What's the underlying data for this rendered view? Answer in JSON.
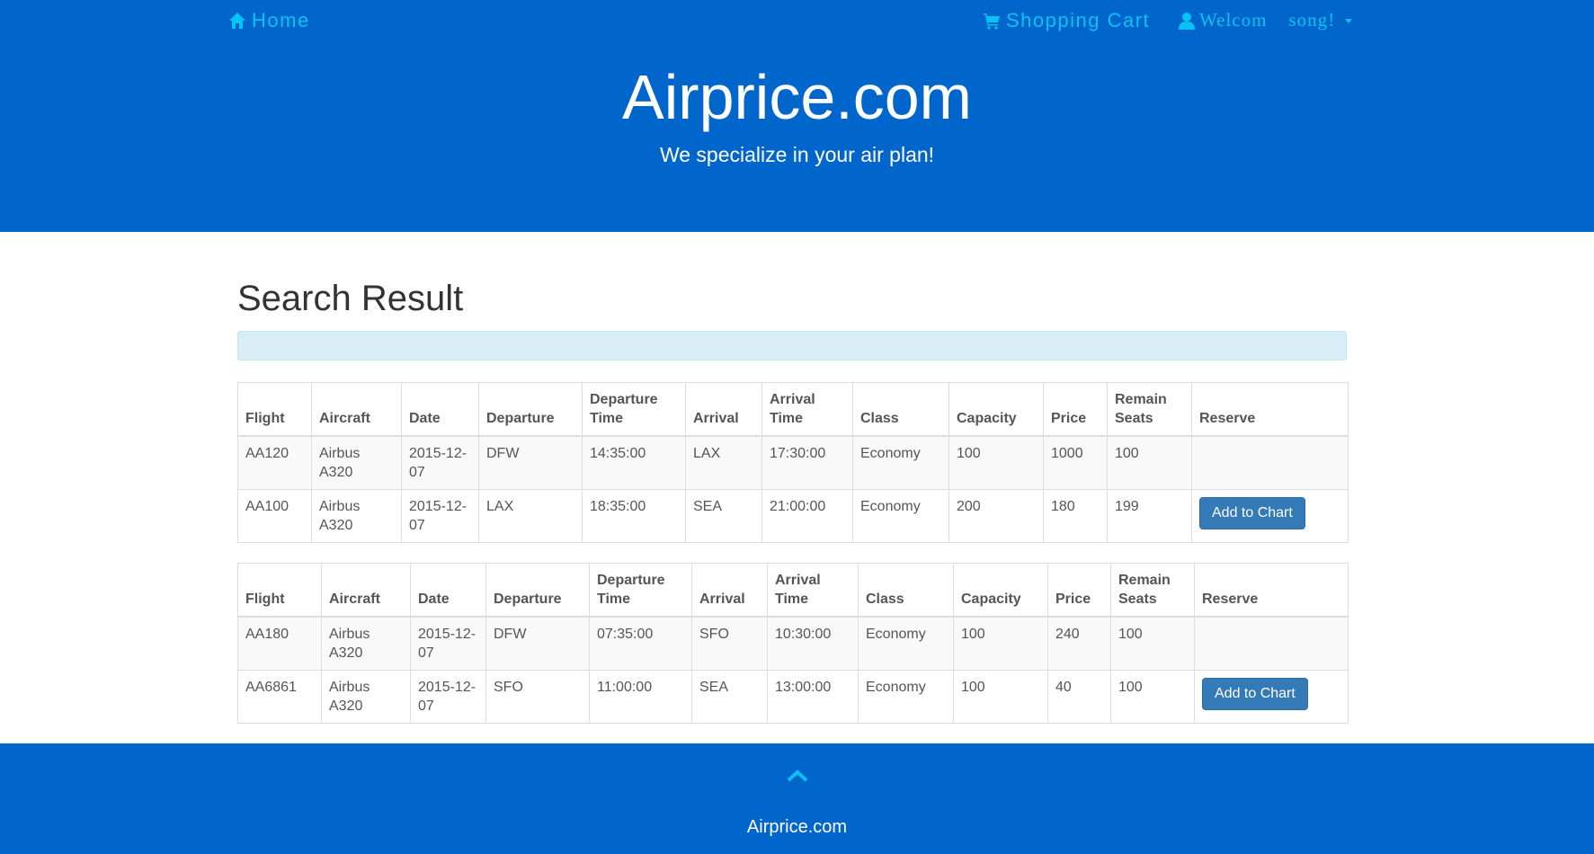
{
  "nav": {
    "home_label": "Home",
    "cart_label": "Shopping Cart",
    "welcome_label": "Welcom",
    "username": "song!"
  },
  "hero": {
    "title": "Airprice.com",
    "subtitle": "We specialize in your air plan!"
  },
  "main": {
    "heading": "Search Result"
  },
  "table_headers": {
    "flight": "Flight",
    "aircraft": "Aircraft",
    "date": "Date",
    "departure": "Departure",
    "departure_time": "Departure Time",
    "arrival": "Arrival",
    "arrival_time": "Arrival Time",
    "class": "Class",
    "capacity": "Capacity",
    "price": "Price",
    "remain_seats": "Remain Seats",
    "reserve": "Reserve"
  },
  "tables": [
    {
      "rows": [
        {
          "flight": "AA120",
          "aircraft": "Airbus A320",
          "date": "2015-12-07",
          "departure": "DFW",
          "departure_time": "14:35:00",
          "arrival": "LAX",
          "arrival_time": "17:30:00",
          "class": "Economy",
          "capacity": "100",
          "price": "1000",
          "remain_seats": "100",
          "reserve": ""
        },
        {
          "flight": "AA100",
          "aircraft": "Airbus A320",
          "date": "2015-12-07",
          "departure": "LAX",
          "departure_time": "18:35:00",
          "arrival": "SEA",
          "arrival_time": "21:00:00",
          "class": "Economy",
          "capacity": "200",
          "price": "180",
          "remain_seats": "199",
          "reserve": "Add to Chart"
        }
      ]
    },
    {
      "rows": [
        {
          "flight": "AA180",
          "aircraft": "Airbus A320",
          "date": "2015-12-07",
          "departure": "DFW",
          "departure_time": "07:35:00",
          "arrival": "SFO",
          "arrival_time": "10:30:00",
          "class": "Economy",
          "capacity": "100",
          "price": "240",
          "remain_seats": "100",
          "reserve": ""
        },
        {
          "flight": "AA6861",
          "aircraft": "Airbus A320",
          "date": "2015-12-07",
          "departure": "SFO",
          "departure_time": "11:00:00",
          "arrival": "SEA",
          "arrival_time": "13:00:00",
          "class": "Economy",
          "capacity": "100",
          "price": "40",
          "remain_seats": "100",
          "reserve": "Add to Chart"
        }
      ]
    }
  ],
  "footer": {
    "text": "Airprice.com",
    "icons": {
      "up": "chevron-up-icon"
    }
  },
  "icons": {
    "home": "home-icon",
    "cart": "shopping-cart-icon",
    "user": "user-icon"
  },
  "colors": {
    "primary": "#0066cc",
    "nav_link": "#0ac2f2",
    "button": "#337ab7",
    "info_bar": "#d9edf7"
  }
}
